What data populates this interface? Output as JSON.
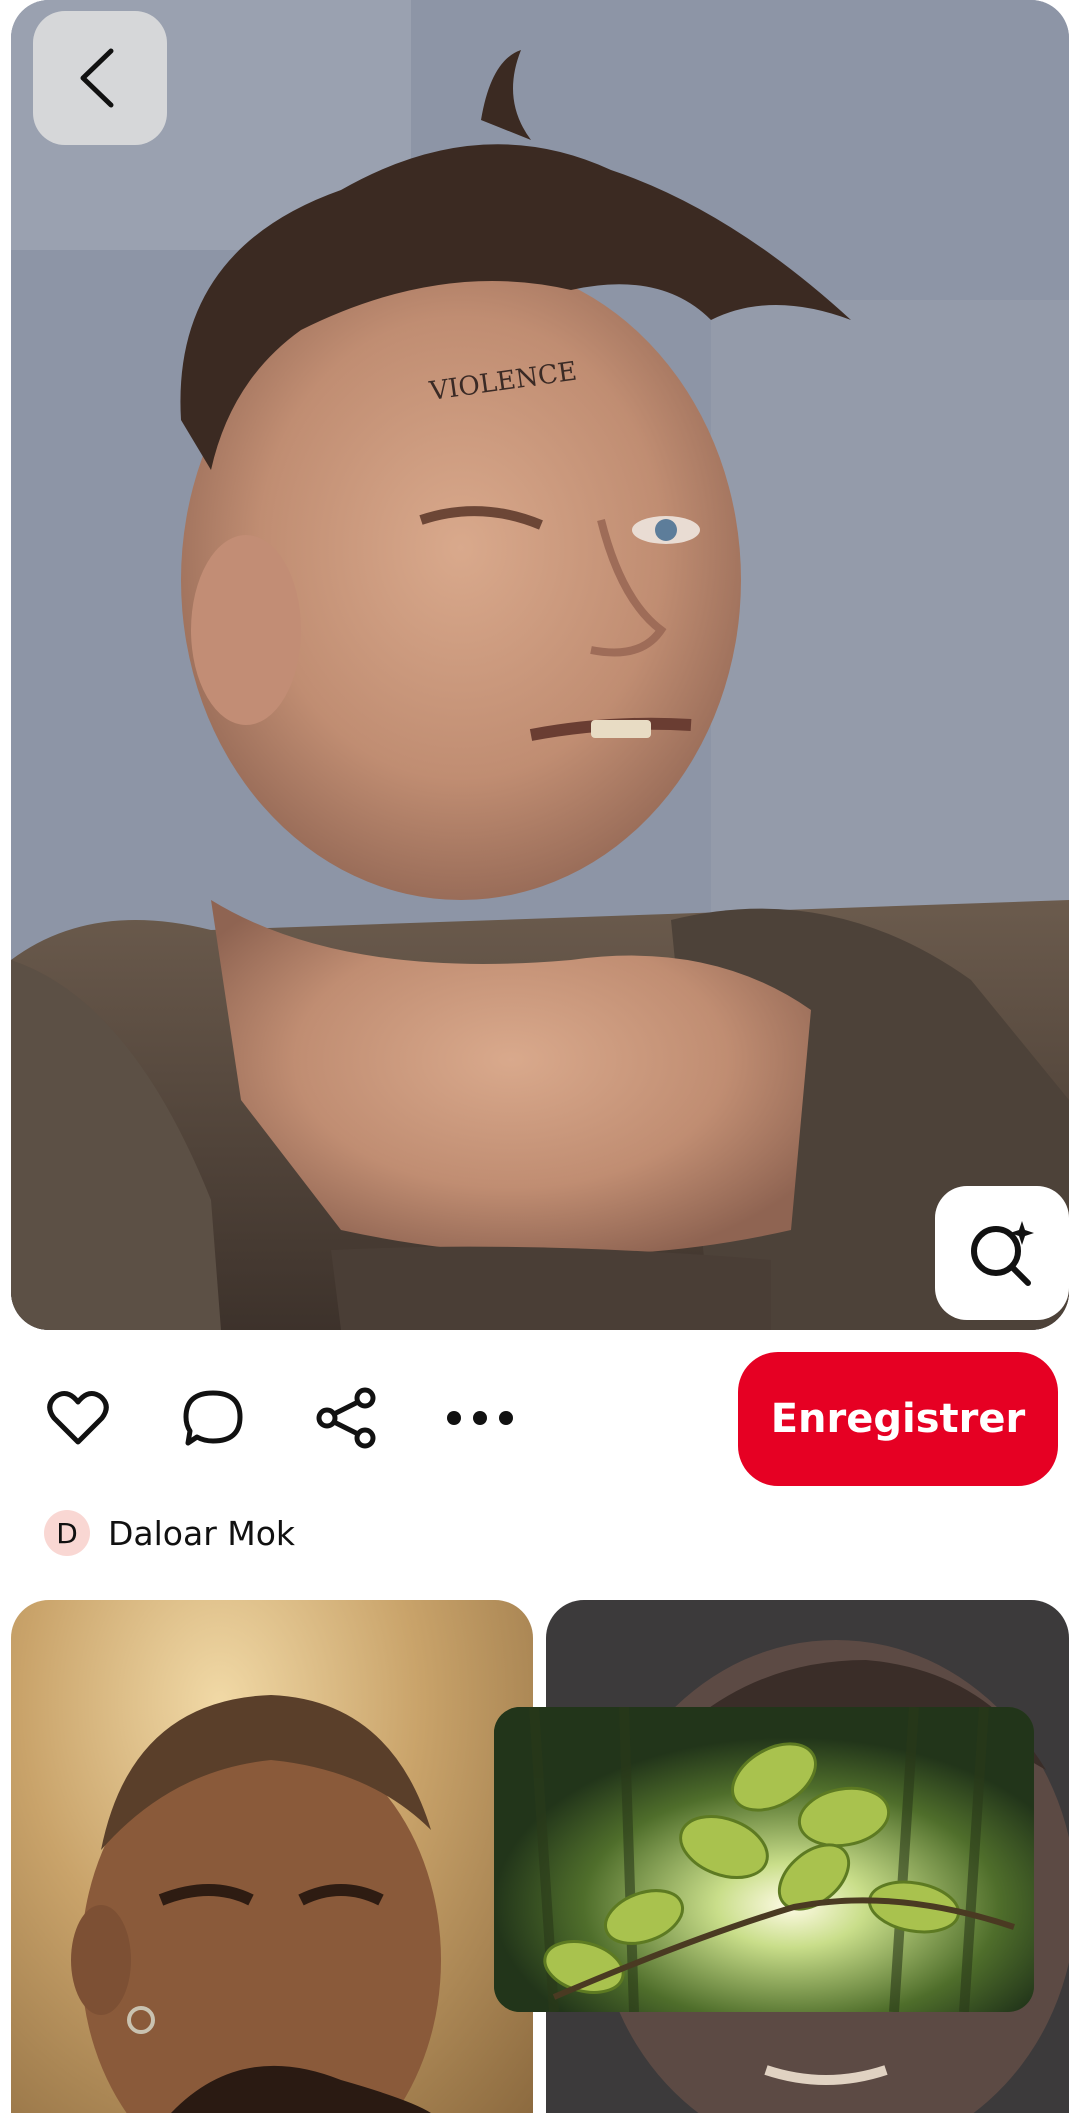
{
  "pin": {
    "image_alt": "Portrait of a scarred brawler",
    "forehead_text": "VIOLENCE",
    "back_icon": "chevron-left-icon",
    "lens_icon": "visual-search-icon"
  },
  "actions": {
    "like_icon": "heart-icon",
    "comment_icon": "comment-icon",
    "share_icon": "share-icon",
    "more_icon": "more-icon",
    "save_label": "Enregistrer",
    "save_color": "#e60023"
  },
  "author": {
    "initial": "D",
    "name": "Daloar Mok",
    "avatar_color": "#f9d7d3"
  },
  "related": {
    "video_icon": "video-thumbnail"
  }
}
